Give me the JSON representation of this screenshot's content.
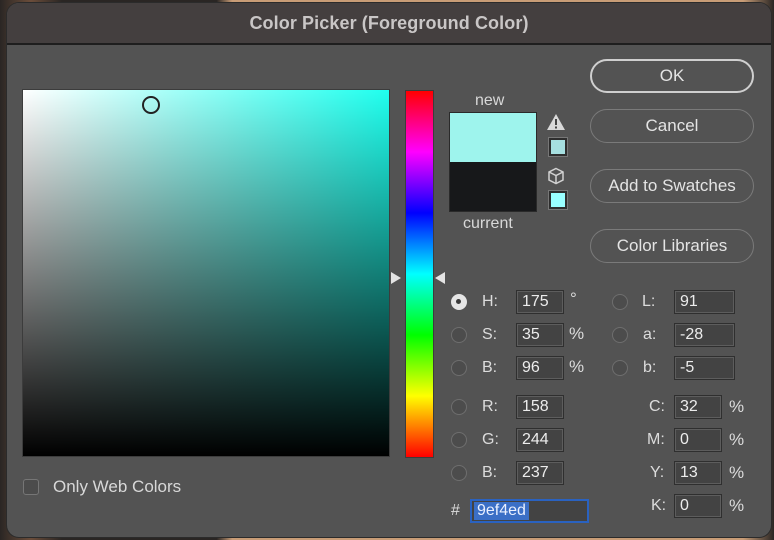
{
  "window": {
    "title": "Color Picker (Foreground Color)"
  },
  "picker": {
    "hue_color": "#1fffee",
    "cursor_saturation_pct": 35,
    "cursor_brightness_pct": 96,
    "hue_degrees": 175
  },
  "preview": {
    "new_label": "new",
    "current_label": "current",
    "new_color": "#9ef4ed",
    "current_color": "#17181a",
    "gamut_warning_icon": "warning-icon",
    "gamut_swatch_color": "#a6dfe0",
    "web_safe_icon": "cube-icon",
    "web_safe_swatch_color": "#99ffff"
  },
  "buttons": {
    "ok": "OK",
    "cancel": "Cancel",
    "add_to_swatches": "Add to Swatches",
    "color_libraries": "Color Libraries"
  },
  "hsb": {
    "h_label": "H:",
    "h_value": "175",
    "h_unit": "°",
    "s_label": "S:",
    "s_value": "35",
    "s_unit": "%",
    "b_label": "B:",
    "b_value": "96",
    "b_unit": "%",
    "selected": "H"
  },
  "lab": {
    "l_label": "L:",
    "l_value": "91",
    "a_label": "a:",
    "a_value": "-28",
    "b_label": "b:",
    "b_value": "-5"
  },
  "rgb": {
    "r_label": "R:",
    "r_value": "158",
    "g_label": "G:",
    "g_value": "244",
    "b_label": "B:",
    "b_value": "237"
  },
  "cmyk": {
    "c_label": "C:",
    "c_value": "32",
    "m_label": "M:",
    "m_value": "0",
    "y_label": "Y:",
    "y_value": "13",
    "k_label": "K:",
    "k_value": "0",
    "unit": "%"
  },
  "hex": {
    "prefix": "#",
    "value": "9ef4ed"
  },
  "options": {
    "only_web_colors_label": "Only Web Colors",
    "only_web_colors_checked": false
  }
}
